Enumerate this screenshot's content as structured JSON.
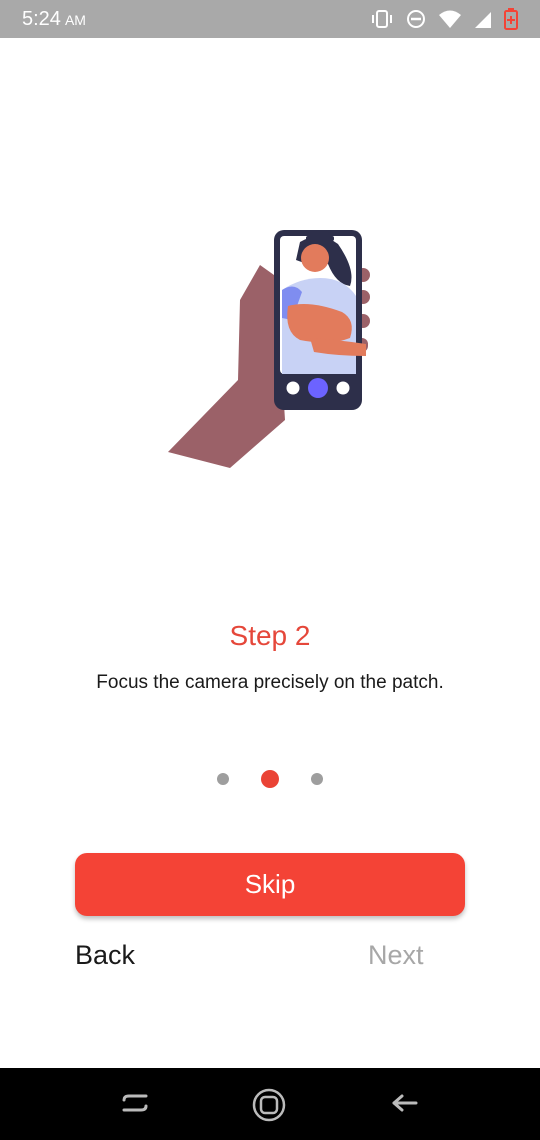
{
  "status_bar": {
    "time": "5:24",
    "ampm": "AM"
  },
  "onboarding": {
    "title": "Step 2",
    "description": "Focus the camera precisely on the patch.",
    "page_indicator": {
      "total": 3,
      "current": 2
    },
    "accent_color": "#f44336"
  },
  "actions": {
    "skip_label": "Skip",
    "back_label": "Back",
    "next_label": "Next"
  },
  "icons": {
    "status": [
      "vibrate-icon",
      "do-not-disturb-icon",
      "wifi-icon",
      "signal-icon",
      "battery-icon"
    ],
    "nav": [
      "recents-icon",
      "home-icon",
      "back-arrow-icon"
    ]
  }
}
